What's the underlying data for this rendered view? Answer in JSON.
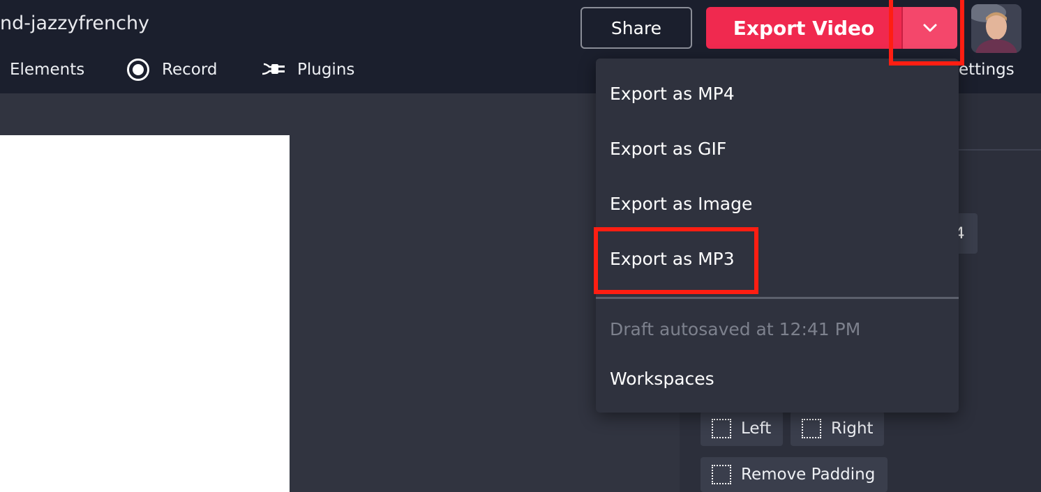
{
  "header": {
    "project_name": "nd-jazzyfrenchy",
    "share_label": "Share",
    "export_label": "Export Video",
    "chevron_icon": "chevron-down-icon",
    "avatar_icon": "user-avatar"
  },
  "nav": {
    "items": [
      {
        "label": "Elements"
      },
      {
        "label": "Record",
        "icon": "record-icon"
      },
      {
        "label": "Plugins",
        "icon": "plug-icon"
      }
    ],
    "settings_label": "ettings"
  },
  "dropdown": {
    "items": [
      {
        "label": "Export as MP4"
      },
      {
        "label": "Export as GIF"
      },
      {
        "label": "Export as Image"
      },
      {
        "label": "Export as MP3"
      }
    ],
    "status": "Draft autosaved at 12:41 PM",
    "workspaces_label": "Workspaces"
  },
  "panel": {
    "chip_label": "4",
    "padding_left_label": "Left",
    "padding_right_label": "Right",
    "remove_padding_label": "Remove Padding"
  },
  "colors": {
    "topbar": "#1b1f2d",
    "workspace": "#313440",
    "accent": "#f0294f",
    "highlight": "#ff1e12"
  }
}
